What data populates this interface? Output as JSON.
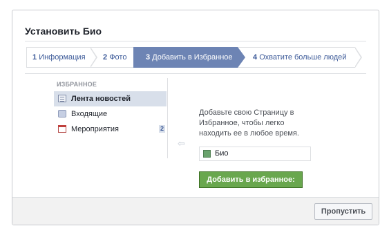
{
  "dialog": {
    "title": "Установить Био"
  },
  "steps": [
    {
      "number": "1",
      "label": "Информация"
    },
    {
      "number": "2",
      "label": "Фото"
    },
    {
      "number": "3",
      "label": "Добавить в Избранное"
    },
    {
      "number": "4",
      "label": "Охватите больше людей"
    }
  ],
  "favorites": {
    "header": "ИЗБРАННОЕ",
    "items": [
      {
        "label": "Лента новостей",
        "icon": "news-feed-icon"
      },
      {
        "label": "Входящие",
        "icon": "inbox-icon"
      },
      {
        "label": "Мероприятия",
        "icon": "events-calendar-icon",
        "badge": "2"
      }
    ]
  },
  "instructions": {
    "text": "Добавьте свою Страницу в Избранное, чтобы легко находить ее в любое время.",
    "page_name": "Био",
    "add_button": "Добавить в избранное:"
  },
  "footer": {
    "skip_button": "Пропустить"
  },
  "colors": {
    "active_step": "#6d84b4",
    "add_button": "#69a74e",
    "link": "#3b5998"
  }
}
